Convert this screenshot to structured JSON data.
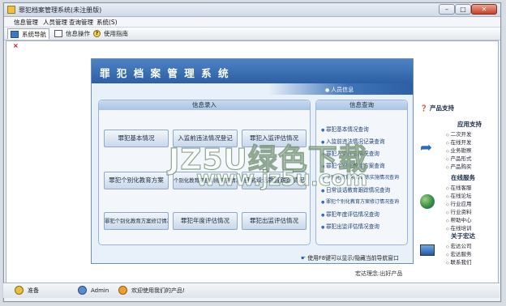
{
  "window": {
    "title": "罪犯档案管理系统(未注册版)"
  },
  "menu": [
    "信息管理",
    "人员管理",
    "查询管理",
    "系统(S)"
  ],
  "toolbar": {
    "nav": "系统导航",
    "info_op": "信息操作",
    "help": "使用指南"
  },
  "panel": {
    "title": "罪 犯 档 案 管 理 系 统",
    "personnel": "人员信息",
    "entry_header": "信息录入",
    "query_header": "信息查询",
    "entry_buttons": [
      "罪犯基本情况",
      "入监前违法情况登记",
      "罪犯入监评估情况",
      "罪犯个别化教育方案",
      "个别化教育项目训练实施情况",
      "日常谈话教育跟踪情况",
      "罪犯个别化教育方案修订情况",
      "罪犯年度评估情况",
      "罪犯出监评估情况"
    ],
    "query_links": [
      "罪犯基本情况查询",
      "入监前违法情况记录查询",
      "罪犯入监评估情况查询",
      "罪犯个别化教育方案查询",
      "个别化教育项目训练实施情况查询",
      "日常谈话教育跟踪情况查询",
      "罪犯个别化教育方案修订情况查询",
      "罪犯年度评估情况查询",
      "罪犯出监评估情况查询"
    ],
    "hint": "使用F8键可以显示/隐藏当前导航窗口"
  },
  "right": {
    "heading": "产品支持",
    "app_support": "应用支持",
    "app_items": [
      "二次开发",
      "在线开发",
      "业务勘察",
      "产品形式",
      "产品购买"
    ],
    "online_service": "在线服务",
    "online_items": [
      "在线客服",
      "在线论坛",
      "行业应用",
      "行业资料",
      "帮助中心",
      "在线培训"
    ],
    "about": "关于宏达",
    "about_items": [
      "宏达公司",
      "宏达服务",
      "联系我们"
    ],
    "slogan": "宏达理念:出好产品"
  },
  "status": {
    "ready": "准备",
    "user": "Admin",
    "welcome": "欢迎使用我们的产品!"
  },
  "watermark": {
    "line1": "JZ5U绿色下载",
    "line2": "www.jz5u.com"
  }
}
